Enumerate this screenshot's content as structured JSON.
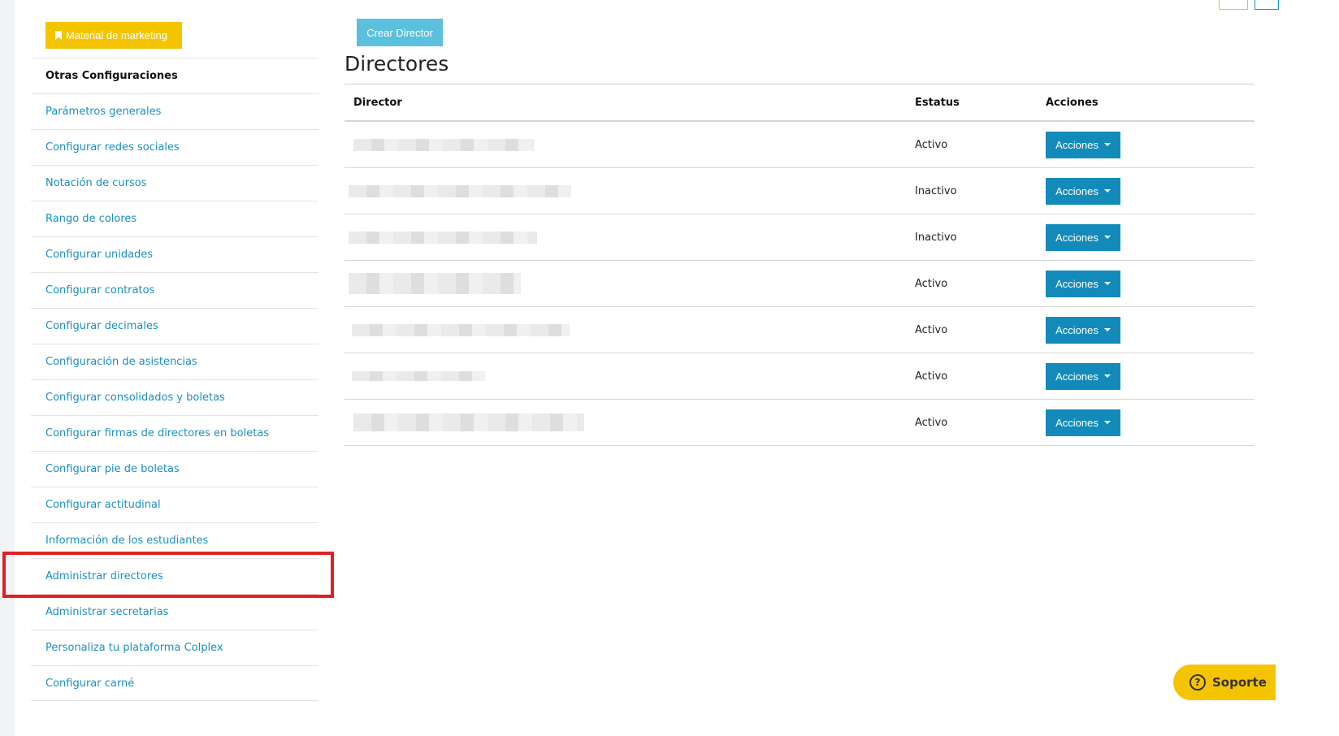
{
  "sidebar": {
    "marketing_label": "Material de marketing",
    "heading": "Otras Configuraciones",
    "items": [
      "Parámetros generales",
      "Configurar redes sociales",
      "Notación de cursos",
      "Rango de colores",
      "Configurar unidades",
      "Configurar contratos",
      "Configurar decimales",
      "Configuración de asistencias",
      "Configurar consolidados y boletas",
      "Configurar firmas de directores en boletas",
      "Configurar pie de boletas",
      "Configurar actitudinal",
      "Información de los estudiantes",
      "Administrar directores",
      "Administrar secretarias",
      "Personaliza tu plataforma Colplex",
      "Configurar carné"
    ]
  },
  "main": {
    "create_label": "Crear Director",
    "title": "Directores",
    "columns": [
      "Director",
      "Estatus",
      "Acciones"
    ],
    "rows": [
      {
        "status": "Activo",
        "action": "Acciones"
      },
      {
        "status": "Inactivo",
        "action": "Acciones"
      },
      {
        "status": "Inactivo",
        "action": "Acciones"
      },
      {
        "status": "Activo",
        "action": "Acciones"
      },
      {
        "status": "Activo",
        "action": "Acciones"
      },
      {
        "status": "Activo",
        "action": "Acciones"
      },
      {
        "status": "Activo",
        "action": "Acciones"
      }
    ]
  },
  "support_label": "Soporte",
  "colors": {
    "brand_yellow": "#f5c400",
    "link_blue": "#1a8fc2",
    "action_blue": "#138bba",
    "highlight_red": "#e02121"
  }
}
